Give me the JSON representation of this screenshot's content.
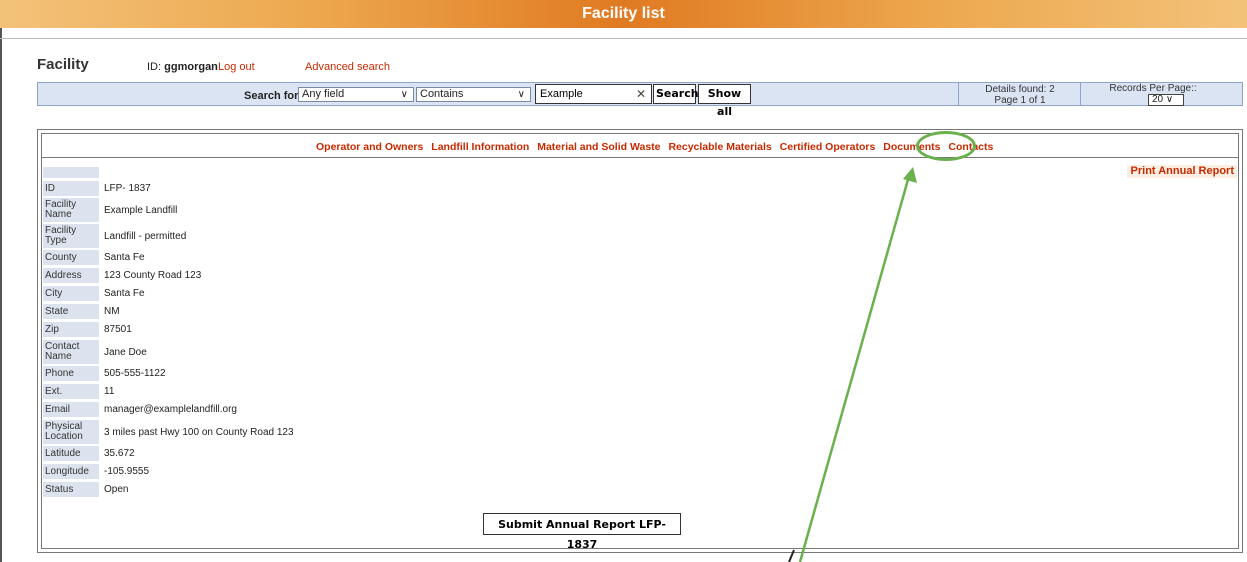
{
  "title": "Facility list",
  "header": {
    "heading": "Facility",
    "id_label": "ID:",
    "username": "ggmorgan",
    "logout": "Log out",
    "advanced_search": "Advanced search"
  },
  "search": {
    "label": "Search for:",
    "field": "Any field",
    "operator": "Contains",
    "value": "Example",
    "search_btn": "Search",
    "show_all_btn": "Show all",
    "details_found": "Details found: 2",
    "page_info": "Page 1 of 1",
    "rpp_label": "Records Per Page::",
    "rpp_value": "20"
  },
  "tabs": [
    "Operator and Owners",
    "Landfill Information",
    "Material and Solid Waste",
    "Recyclable Materials",
    "Certified Operators",
    "Documents",
    "Contacts"
  ],
  "highlighted_tab": "Contacts",
  "print_report": "Print Annual Report",
  "fields": [
    {
      "label": "ID",
      "value": "LFP- 1837"
    },
    {
      "label": "Facility Name",
      "value": "Example Landfill"
    },
    {
      "label": "Facility Type",
      "value": "Landfill - permitted"
    },
    {
      "label": "County",
      "value": "Santa Fe"
    },
    {
      "label": "Address",
      "value": "123 County Road 123"
    },
    {
      "label": "City",
      "value": "Santa Fe"
    },
    {
      "label": "State",
      "value": "NM"
    },
    {
      "label": "Zip",
      "value": "87501"
    },
    {
      "label": "Contact Name",
      "value": "Jane Doe"
    },
    {
      "label": "Phone",
      "value": "505-555-1122"
    },
    {
      "label": "Ext.",
      "value": "11"
    },
    {
      "label": "Email",
      "value": "manager@examplelandfill.org"
    },
    {
      "label": "Physical Location",
      "value": "3 miles past Hwy 100 on County Road 123"
    },
    {
      "label": "Latitude",
      "value": "35.672"
    },
    {
      "label": "Longitude",
      "value": "-105.9555"
    },
    {
      "label": "Status",
      "value": "Open"
    }
  ],
  "submit": "Submit Annual Report LFP- 1837",
  "colors": {
    "accent": "#c62a00",
    "annotation": "#6ab04c",
    "bar": "#dbe4f3"
  },
  "icons": {
    "clear": "close-icon",
    "dropdown": "chevron-down-icon",
    "annotation": "arrow-annotation"
  }
}
